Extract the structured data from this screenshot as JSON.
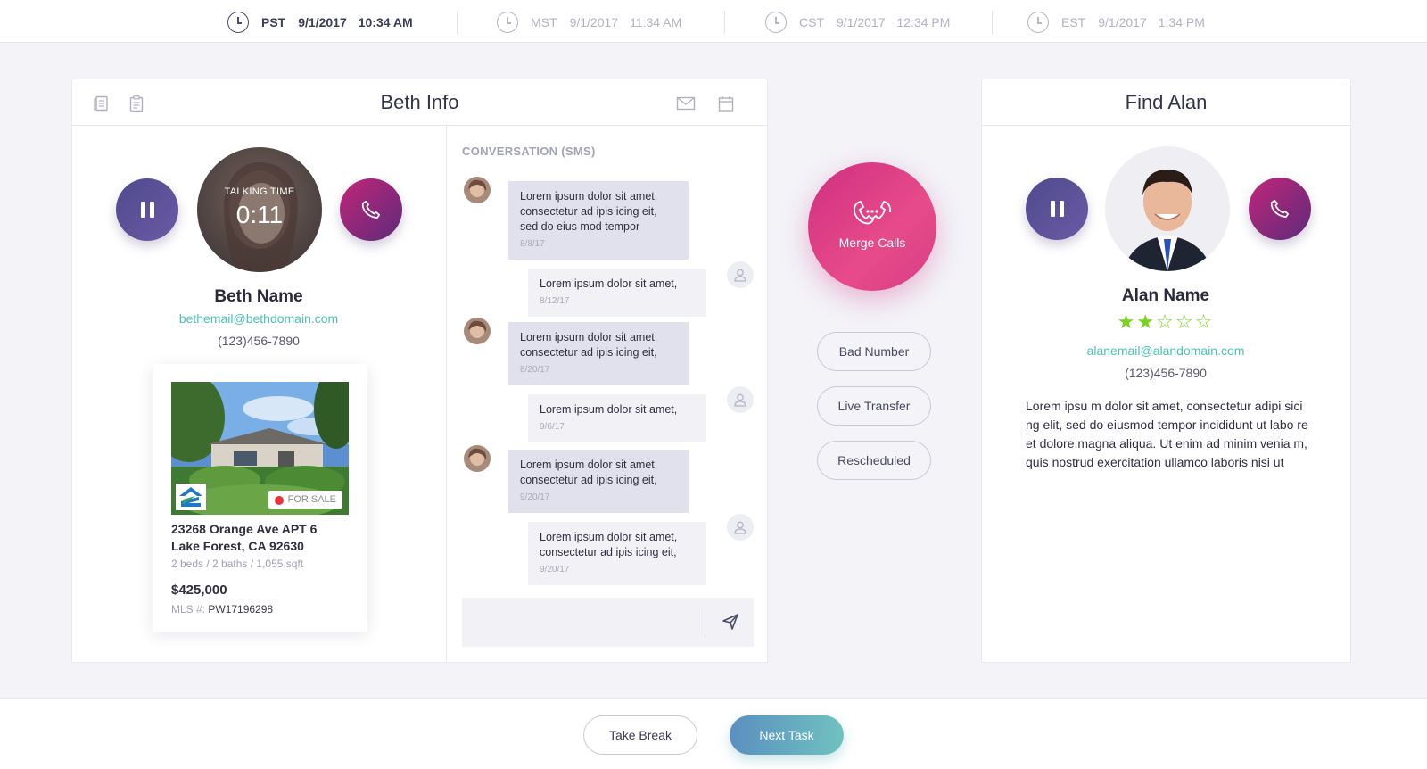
{
  "timezones": [
    {
      "zone": "PST",
      "date": "9/1/2017",
      "time": "10:34 AM",
      "active": true
    },
    {
      "zone": "MST",
      "date": "9/1/2017",
      "time": "11:34 AM",
      "active": false
    },
    {
      "zone": "CST",
      "date": "9/1/2017",
      "time": "12:34 PM",
      "active": false
    },
    {
      "zone": "EST",
      "date": "9/1/2017",
      "time": "1:34 PM",
      "active": false
    }
  ],
  "beth": {
    "title": "Beth Info",
    "talking_label": "TALKING TIME",
    "talking_time": "0:11",
    "name": "Beth Name",
    "email": "bethemail@bethdomain.com",
    "phone": "(123)456-7890",
    "listing": {
      "badge": "FOR SALE",
      "address_line1": "23268 Orange Ave APT 6",
      "address_line2": "Lake Forest, CA 92630",
      "specs": "2 beds  / 2 baths  / 1,055 sqft",
      "price": "$425,000",
      "mls_label": "MLS #:",
      "mls_value": "PW17196298"
    }
  },
  "conversation": {
    "title": "CONVERSATION (SMS)",
    "messages": [
      {
        "dir": "in",
        "text": "Lorem ipsum dolor sit amet, consectetur ad ipis icing eit, sed do eius mod tempor",
        "time": "8/8/17"
      },
      {
        "dir": "out",
        "text": "Lorem ipsum dolor sit amet,",
        "time": "8/12/17"
      },
      {
        "dir": "in",
        "text": "Lorem ipsum dolor sit amet, consectetur ad ipis icing eit,",
        "time": "8/20/17"
      },
      {
        "dir": "out",
        "text": "Lorem ipsum dolor sit amet,",
        "time": "9/6/17"
      },
      {
        "dir": "in",
        "text": "Lorem ipsum dolor sit amet, consectetur ad ipis icing eit,",
        "time": "9/20/17"
      },
      {
        "dir": "out",
        "text": "Lorem ipsum dolor sit amet, consectetur ad ipis icing eit,",
        "time": "9/20/17"
      }
    ],
    "compose_placeholder": ""
  },
  "merge": {
    "label": "Merge Calls"
  },
  "outcomes": [
    "Bad Number",
    "Live Transfer",
    "Rescheduled"
  ],
  "alan": {
    "title": "Find Alan",
    "name": "Alan Name",
    "rating": 2,
    "rating_max": 5,
    "email": "alanemail@alandomain.com",
    "phone": "(123)456-7890",
    "bio": "Lorem ipsu m dolor sit amet, consectetur adipi sici ng elit, sed do eiusmod tempor incididunt ut labo re et dolore.magna aliqua. Ut enim ad minim venia m, quis nostrud exercitation ullamco laboris nisi ut"
  },
  "footer": {
    "take_break": "Take Break",
    "next_task": "Next Task"
  },
  "colors": {
    "accent_teal": "#4ec1b7",
    "magenta": "#d63d84",
    "purple": "#5a4f96",
    "star_green": "#7ad11e"
  }
}
